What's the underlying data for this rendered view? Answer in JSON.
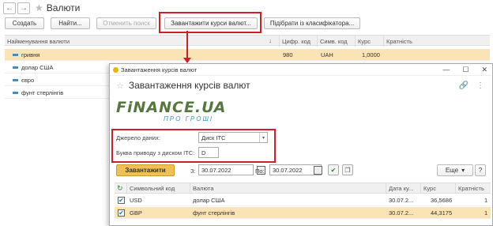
{
  "window": {
    "title": "Валюти"
  },
  "toolbar": {
    "create": "Создать",
    "find": "Найти...",
    "cancel_search": "Отменить поиск",
    "load_rates": "Завантажити курси валют...",
    "pick_classifier": "Підібрати із класифікатора..."
  },
  "grid": {
    "columns": [
      "Найменування валюти",
      "Цифр. код",
      "Симв. код",
      "Курс",
      "Кратність"
    ],
    "rows": [
      {
        "name": "гривня",
        "digital": "980",
        "symbol": "UAH",
        "rate": "1,0000",
        "mult": ""
      },
      {
        "name": "долар США",
        "digital": "",
        "symbol": "",
        "rate": "",
        "mult": ""
      },
      {
        "name": "євро",
        "digital": "",
        "symbol": "",
        "rate": "",
        "mult": ""
      },
      {
        "name": "фунт стерлінгів",
        "digital": "",
        "symbol": "",
        "rate": "",
        "mult": ""
      }
    ]
  },
  "dialog": {
    "window_title": "Завантаження курсів валют",
    "heading": "Завантаження курсів валют",
    "logo_main": "FiNANCE.UA",
    "logo_sub": "ПРО ГРОШІ",
    "source_label": "Джерело даних:",
    "source_value": "Диск ITC",
    "drive_label": "Буква приводу з диском ITC:",
    "drive_value": "D",
    "load_button": "Завантажити",
    "from_label": "З:",
    "from_date": "30.07.2022",
    "to_label": "По:",
    "to_date": "30.07.2022",
    "more_button": "Еще",
    "table": {
      "columns": [
        "Символьний код",
        "Валюта",
        "Дата ку...",
        "Курс",
        "Кратність"
      ],
      "rows": [
        {
          "code": "USD",
          "currency": "долар США",
          "date": "30.07.2...",
          "rate": "36,5686",
          "mult": "1",
          "checked": true
        },
        {
          "code": "GBP",
          "currency": "фунт стерлінгів",
          "date": "30.07.2...",
          "rate": "44,3175",
          "mult": "1",
          "checked": true
        }
      ]
    }
  },
  "colors": {
    "highlight": "#d21d2a",
    "selected_row": "#fae3b4",
    "load_button": "#f0c054"
  }
}
